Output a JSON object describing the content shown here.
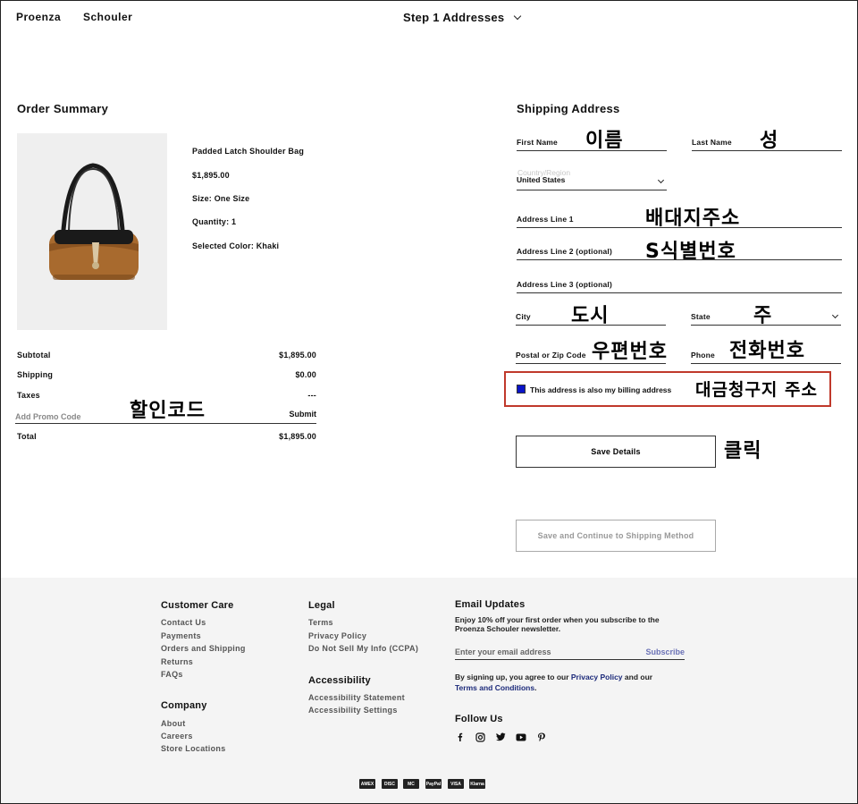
{
  "header": {
    "logo_left": "Proenza",
    "logo_right": "Schouler",
    "step_title": "Step 1 Addresses"
  },
  "order_summary": {
    "title": "Order Summary",
    "product": {
      "name": "Padded Latch Shoulder Bag",
      "price": "$1,895.00",
      "size": "Size:  One Size",
      "quantity": "Quantity:  1",
      "color": "Selected Color: Khaki"
    },
    "subtotal_label": "Subtotal",
    "subtotal_value": "$1,895.00",
    "shipping_label": "Shipping",
    "shipping_value": "$0.00",
    "taxes_label": "Taxes",
    "taxes_value": "---",
    "promo_placeholder": "Add Promo Code",
    "promo_submit": "Submit",
    "total_label": "Total",
    "total_value": "$1,895.00"
  },
  "shipping": {
    "title": "Shipping Address",
    "first_name_label": "First Name",
    "last_name_label": "Last Name",
    "country_label": "Country/Region",
    "country_value": "United States",
    "address1_label": "Address Line 1",
    "address2_label": "Address Line 2 (optional)",
    "address3_label": "Address Line 3 (optional)",
    "city_label": "City",
    "state_label": "State",
    "postal_label": "Postal or Zip Code",
    "phone_label": "Phone",
    "billing_label": "This address is also my billing address",
    "save_details": "Save Details",
    "save_continue": "Save and Continue to Shipping Method"
  },
  "annotations": {
    "first_name": "이름",
    "last_name": "성",
    "address1": "배대지주소",
    "address2": "S식별번호",
    "city": "도시",
    "state": "주",
    "postal": "우편번호",
    "phone": "전화번호",
    "billing": "대금청구지 주소",
    "click": "클릭",
    "promo": "할인코드"
  },
  "footer": {
    "customer_care": {
      "title": "Customer Care",
      "links": [
        "Contact Us",
        "Payments",
        "Orders and Shipping",
        "Returns",
        "FAQs"
      ]
    },
    "company": {
      "title": "Company",
      "links": [
        "About",
        "Careers",
        "Store Locations"
      ]
    },
    "legal": {
      "title": "Legal",
      "links": [
        "Terms",
        "Privacy Policy",
        "Do Not Sell My Info (CCPA)"
      ]
    },
    "accessibility": {
      "title": "Accessibility",
      "links": [
        "Accessibility Statement",
        "Accessibility Settings"
      ]
    },
    "email": {
      "title": "Email Updates",
      "desc1": "Enjoy 10% off your first order when you subscribe to the",
      "desc2": "Proenza Schouler newsletter.",
      "placeholder": "Enter your email address",
      "subscribe": "Subscribe",
      "legal_pre": "By signing up, you agree to our",
      "privacy": "Privacy Policy",
      "and": "and our",
      "terms": "Terms and Conditions",
      "period": "."
    },
    "follow_us": "Follow Us",
    "social_icons": [
      "facebook-icon",
      "instagram-icon",
      "twitter-icon",
      "youtube-icon",
      "pinterest-icon"
    ],
    "payment_labels": [
      "AMEX",
      "DISC",
      "MC",
      "PayPal",
      "VISA",
      "Klarna"
    ]
  },
  "colors": {
    "billing_highlight": "#c0392b",
    "checkbox": "#0a14c8",
    "footer_bg": "#f4f4f4",
    "link": "#1c2a7a"
  }
}
